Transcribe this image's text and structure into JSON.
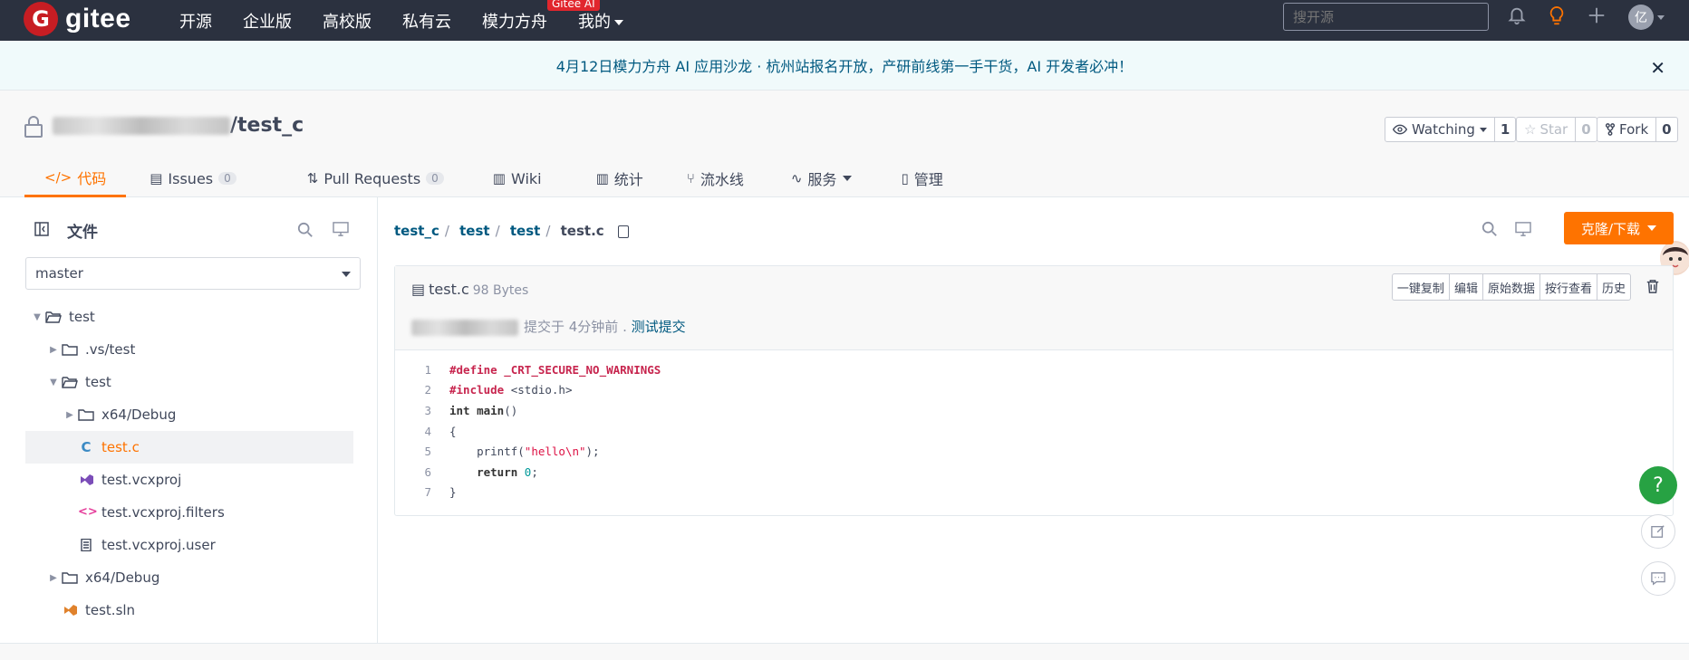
{
  "topnav": {
    "logo_letter": "G",
    "logo_text": "gitee",
    "items": [
      {
        "label": "开源"
      },
      {
        "label": "企业版"
      },
      {
        "label": "高校版"
      },
      {
        "label": "私有云"
      },
      {
        "label": "模力方舟",
        "badge": "Gitee AI"
      },
      {
        "label": "我的"
      }
    ],
    "search_placeholder": "搜开源",
    "avatar_text": "亿"
  },
  "banner": {
    "text": "4月12日模力方舟 AI 应用沙龙 · 杭州站报名开放，产研前线第一手干货，AI 开发者必冲！",
    "close": "✕"
  },
  "repo": {
    "name_suffix": "/test_c",
    "watching": {
      "label": "Watching",
      "count": "1"
    },
    "star": {
      "label": "Star",
      "count": "0"
    },
    "fork": {
      "label": "Fork",
      "count": "0"
    }
  },
  "tabs": [
    {
      "label": "代码",
      "icon": "</>"
    },
    {
      "label": "Issues",
      "count": "0"
    },
    {
      "label": "Pull Requests",
      "count": "0"
    },
    {
      "label": "Wiki"
    },
    {
      "label": "统计"
    },
    {
      "label": "流水线"
    },
    {
      "label": "服务"
    },
    {
      "label": "管理"
    }
  ],
  "sidebar": {
    "title": "文件",
    "branch": "master",
    "tree": [
      {
        "label": "test",
        "depth": 0,
        "type": "folder-open",
        "twisty": "▼"
      },
      {
        "label": ".vs/test",
        "depth": 1,
        "type": "folder",
        "twisty": "▶"
      },
      {
        "label": "test",
        "depth": 1,
        "type": "folder-open",
        "twisty": "▼"
      },
      {
        "label": "x64/Debug",
        "depth": 2,
        "type": "folder",
        "twisty": "▶"
      },
      {
        "label": "test.c",
        "depth": 2,
        "type": "c-file",
        "twisty": "",
        "selected": true
      },
      {
        "label": "test.vcxproj",
        "depth": 2,
        "type": "vs-file",
        "twisty": ""
      },
      {
        "label": "test.vcxproj.filters",
        "depth": 2,
        "type": "code-file",
        "twisty": ""
      },
      {
        "label": "test.vcxproj.user",
        "depth": 2,
        "type": "doc-file",
        "twisty": ""
      },
      {
        "label": "x64/Debug",
        "depth": 1,
        "type": "folder",
        "twisty": "▶"
      },
      {
        "label": "test.sln",
        "depth": 1,
        "type": "sln-file",
        "twisty": ""
      }
    ]
  },
  "main": {
    "breadcrumb": [
      "test_c",
      "test",
      "test",
      "test.c"
    ],
    "clone_label": "克隆/下载",
    "file": {
      "name": "test.c",
      "size": "98 Bytes",
      "buttons": [
        "一键复制",
        "编辑",
        "原始数据",
        "按行查看",
        "历史"
      ],
      "commit_text": "提交于 4分钟前 .",
      "commit_msg": "测试提交"
    },
    "code_lines": [
      {
        "n": "1"
      },
      {
        "n": "2"
      },
      {
        "n": "3"
      },
      {
        "n": "4"
      },
      {
        "n": "5"
      },
      {
        "n": "6"
      },
      {
        "n": "7"
      }
    ]
  },
  "float": {
    "help": "?"
  }
}
